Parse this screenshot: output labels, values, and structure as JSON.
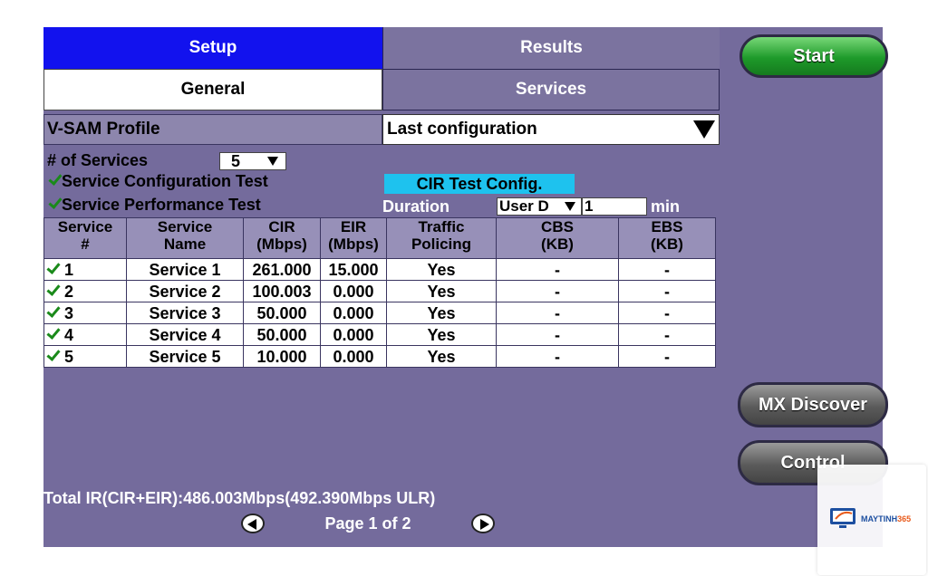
{
  "tabs": {
    "setup": "Setup",
    "results": "Results",
    "general": "General",
    "services": "Services"
  },
  "profile": {
    "label": "V-SAM Profile",
    "value": "Last configuration"
  },
  "num_services": {
    "label": "# of Services",
    "value": "5"
  },
  "tests": {
    "config_label": "Service Configuration Test",
    "config_checked": true,
    "performance_label": "Service Performance Test",
    "performance_checked": true
  },
  "cir_config": {
    "label": "CIR Test Config."
  },
  "duration": {
    "label": "Duration",
    "mode": "User D",
    "value": "1",
    "unit": "min"
  },
  "table": {
    "headers": [
      [
        "Service",
        "#"
      ],
      [
        "Service",
        "Name"
      ],
      [
        "CIR",
        "(Mbps)"
      ],
      [
        "EIR",
        "(Mbps)"
      ],
      [
        "Traffic",
        "Policing"
      ],
      [
        "CBS",
        "(KB)"
      ],
      [
        "EBS",
        "(KB)"
      ]
    ],
    "rows": [
      {
        "num": "1",
        "name": "Service 1",
        "cir": "261.000",
        "eir": "15.000",
        "policing": "Yes",
        "cbs": "-",
        "ebs": "-",
        "checked": true
      },
      {
        "num": "2",
        "name": "Service 2",
        "cir": "100.003",
        "eir": "0.000",
        "policing": "Yes",
        "cbs": "-",
        "ebs": "-",
        "checked": true
      },
      {
        "num": "3",
        "name": "Service 3",
        "cir": "50.000",
        "eir": "0.000",
        "policing": "Yes",
        "cbs": "-",
        "ebs": "-",
        "checked": true
      },
      {
        "num": "4",
        "name": "Service 4",
        "cir": "50.000",
        "eir": "0.000",
        "policing": "Yes",
        "cbs": "-",
        "ebs": "-",
        "checked": true
      },
      {
        "num": "5",
        "name": "Service 5",
        "cir": "10.000",
        "eir": "0.000",
        "policing": "Yes",
        "cbs": "-",
        "ebs": "-",
        "checked": true
      }
    ]
  },
  "total": "Total IR(CIR+EIR):486.003Mbps(492.390Mbps ULR)",
  "pagination": {
    "label": "Page 1 of 2"
  },
  "buttons": {
    "start": "Start",
    "mx_discover": "MX Discover",
    "control": "Control"
  },
  "watermark": {
    "brand_main": "MAYTINH",
    "brand_accent": "365"
  },
  "colors": {
    "active_tab": "#1212ee",
    "start_button": "#1e9a2a",
    "cir_button": "#1ec2ee",
    "panel": "#746b9c"
  }
}
